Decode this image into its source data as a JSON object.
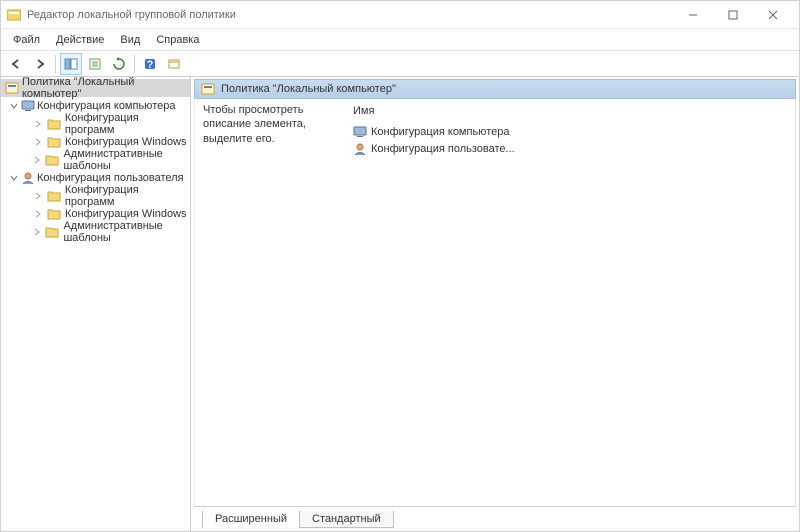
{
  "window": {
    "title": "Редактор локальной групповой политики",
    "minimize": "—",
    "maximize": "□",
    "close": "×"
  },
  "menu": {
    "file": "Файл",
    "action": "Действие",
    "view": "Вид",
    "help": "Справка"
  },
  "toolbar": {
    "back": "back-icon",
    "forward": "forward-icon",
    "up": "up-icon",
    "show_hide": "show-hide-tree-icon",
    "export": "export-list-icon",
    "refresh": "refresh-icon",
    "help": "help-icon",
    "props": "properties-icon"
  },
  "tree": {
    "root": "Политика \"Локальный компьютер\"",
    "computer": {
      "label": "Конфигурация компьютера",
      "programs": "Конфигурация программ",
      "windows": "Конфигурация Windows",
      "templates": "Административные шаблоны"
    },
    "user": {
      "label": "Конфигурация пользователя",
      "programs": "Конфигурация программ",
      "windows": "Конфигурация Windows",
      "templates": "Административные шаблоны"
    }
  },
  "details": {
    "header": "Политика \"Локальный компьютер\"",
    "description_hint": "Чтобы просмотреть описание элемента, выделите его.",
    "name_col": "Имя",
    "items": {
      "computer": "Конфигурация компьютера",
      "user": "Конфигурация пользовате..."
    }
  },
  "tabs": {
    "extended": "Расширенный",
    "standard": "Стандартный"
  },
  "icons": {
    "folder": "folder-icon",
    "computer_config": "computer-config-icon",
    "user_config": "user-config-icon",
    "policy": "policy-icon"
  }
}
